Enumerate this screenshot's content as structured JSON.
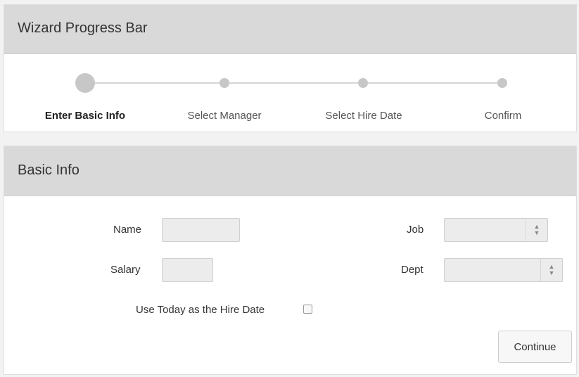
{
  "wizard": {
    "title": "Wizard Progress Bar",
    "steps": [
      {
        "label": "Enter Basic Info",
        "active": true
      },
      {
        "label": "Select Manager",
        "active": false
      },
      {
        "label": "Select Hire Date",
        "active": false
      },
      {
        "label": "Confirm",
        "active": false
      }
    ]
  },
  "basic_info": {
    "title": "Basic Info",
    "name_label": "Name",
    "name_value": "",
    "salary_label": "Salary",
    "salary_value": "",
    "job_label": "Job",
    "job_value": "",
    "dept_label": "Dept",
    "dept_value": "",
    "select_icon": "up-down-caret-icon",
    "hire_date_label": "Use Today as the Hire Date",
    "hire_date_checked": false,
    "continue_label": "Continue"
  }
}
